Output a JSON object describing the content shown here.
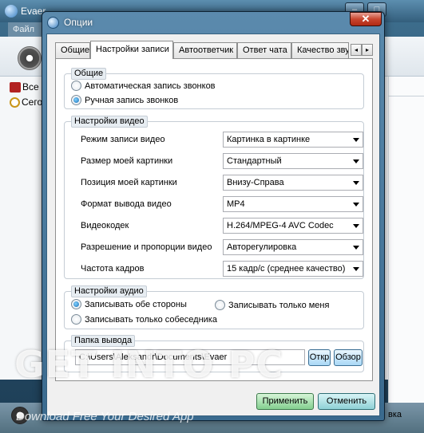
{
  "background_app": {
    "title": "Evaer",
    "menu": "Файл",
    "contacts": [
      "Все",
      "Сегод"
    ],
    "bottom_text": "вка",
    "window_controls": [
      "–",
      "□"
    ]
  },
  "dialog": {
    "title": "Опции",
    "close_label": "✕",
    "tabs": [
      "Общие",
      "Настройки записи",
      "Автоответчик",
      "Ответ чата",
      "Качество зву"
    ],
    "tab_scroll_left": "◂",
    "tab_scroll_right": "▸",
    "groups": {
      "general": {
        "legend": "Общие",
        "options": [
          "Автоматическая запись звонков",
          "Ручная запись звонков"
        ],
        "selected_index": 1
      },
      "video": {
        "legend": "Настройки видео",
        "fields": [
          {
            "label": "Режим записи видео",
            "value": "Картинка в картинке"
          },
          {
            "label": "Размер моей картинки",
            "value": "Стандартный"
          },
          {
            "label": "Позиция моей картинки",
            "value": "Внизу-Справа"
          },
          {
            "label": "Формат вывода видео",
            "value": "MP4"
          },
          {
            "label": "Видеокодек",
            "value": "H.264/MPEG-4 AVC Codec"
          },
          {
            "label": "Разрешение и пропорции видео",
            "value": "Авторегулировка"
          },
          {
            "label": "Частота кадров",
            "value": "15 кадр/с (среднее качество)"
          }
        ]
      },
      "audio": {
        "legend": "Настройки аудио",
        "options": [
          "Записывать обе стороны",
          "Записывать только меня",
          "Записывать только собеседника"
        ],
        "selected_index": 0
      },
      "output": {
        "legend": "Папка вывода",
        "path": "C:\\Users\\Aleksandr\\Documents\\Evaer",
        "open_label": "Откр",
        "browse_label": "Обзор"
      }
    },
    "apply_label": "Применить",
    "cancel_label": "Отменить"
  },
  "watermark": {
    "main_1": "GET ",
    "main_2": "INTO",
    "main_3": " PC",
    "sub": "Download Free Your Desired App"
  }
}
